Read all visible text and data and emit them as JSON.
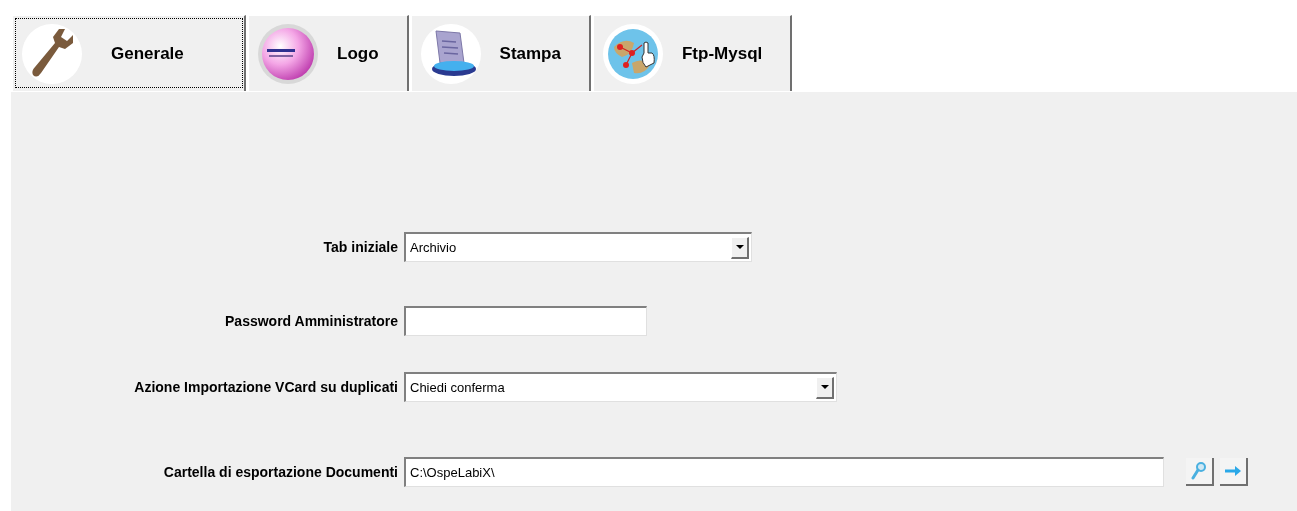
{
  "tabs": [
    {
      "label": "Generale",
      "selected": true
    },
    {
      "label": "Logo",
      "selected": false
    },
    {
      "label": "Stampa",
      "selected": false
    },
    {
      "label": "Ftp-Mysql",
      "selected": false
    }
  ],
  "fields": [
    {
      "label": "Tab iniziale",
      "kind": "combo",
      "value": "Archivio"
    },
    {
      "label": "Password Amministratore",
      "kind": "text"
    },
    {
      "label": "Azione Importazione VCard su duplicati",
      "kind": "combo",
      "value": "Chiedi conferma"
    },
    {
      "label": "Cartella di esportazione Documenti",
      "kind": "folder",
      "value": "C:\\OspeLabiX\\"
    }
  ]
}
